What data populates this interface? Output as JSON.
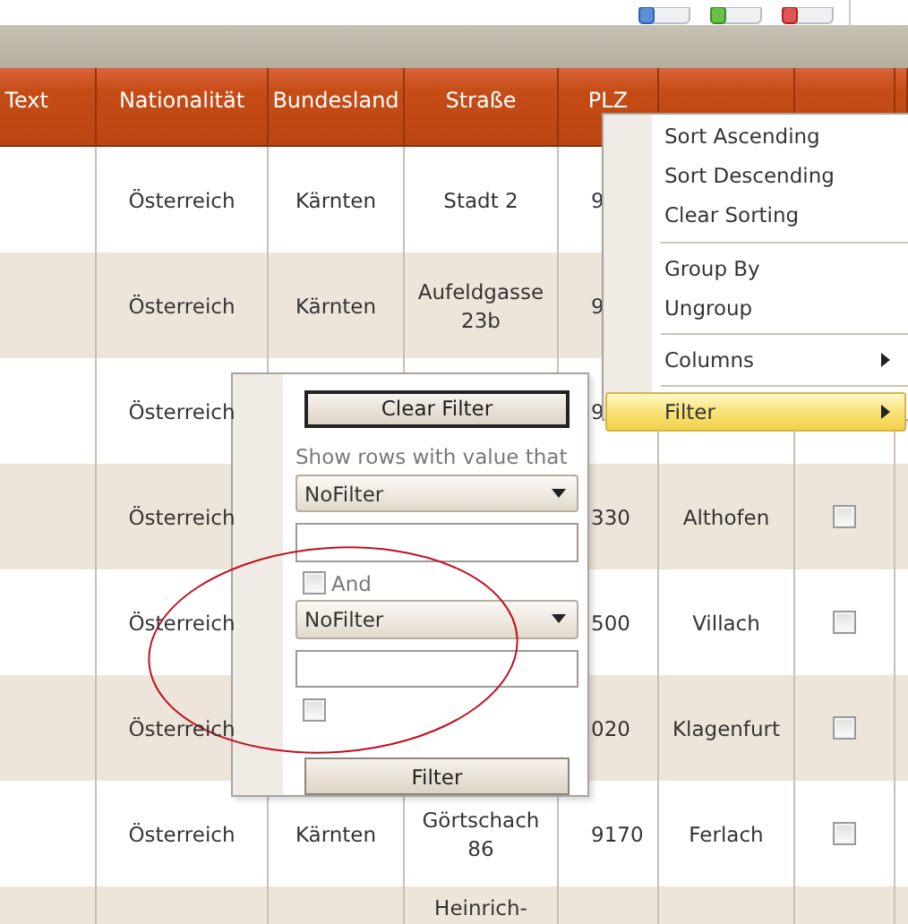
{
  "grid": {
    "columns": [
      {
        "label": "Text"
      },
      {
        "label": "Nationalität"
      },
      {
        "label": "Bundesland"
      },
      {
        "label": "Straße"
      },
      {
        "label": "PLZ"
      },
      {},
      {},
      {}
    ],
    "rows": [
      {
        "cells": [
          {
            "kind": "empty"
          },
          {
            "kind": "text",
            "text": "Österreich"
          },
          {
            "kind": "text",
            "text": "Kärnten"
          },
          {
            "kind": "text",
            "text": "Stadt 2"
          },
          {
            "kind": "text",
            "text": "9"
          },
          {
            "kind": "empty"
          },
          {
            "kind": "empty"
          },
          {
            "kind": "empty"
          }
        ]
      },
      {
        "cells": [
          {
            "kind": "empty"
          },
          {
            "kind": "text",
            "text": "Österreich"
          },
          {
            "kind": "text",
            "text": "Kärnten"
          },
          {
            "kind": "text",
            "text": "Aufeldgasse 23b"
          },
          {
            "kind": "text",
            "text": "9"
          },
          {
            "kind": "covered"
          },
          {
            "kind": "covered"
          },
          {
            "kind": "covered"
          }
        ]
      },
      {
        "cells": [
          {
            "kind": "empty"
          },
          {
            "kind": "text",
            "text": "Österreich"
          },
          {
            "kind": "empty"
          },
          {
            "kind": "empty"
          },
          {
            "kind": "text",
            "text": "9"
          },
          {
            "kind": "empty"
          },
          {
            "kind": "empty"
          },
          {
            "kind": "empty"
          }
        ]
      },
      {
        "cells": [
          {
            "kind": "empty"
          },
          {
            "kind": "text",
            "text": "Österreich"
          },
          {
            "kind": "covered"
          },
          {
            "kind": "covered"
          },
          {
            "kind": "text",
            "text": "330"
          },
          {
            "kind": "text",
            "text": "Althofen"
          },
          {
            "kind": "check",
            "checked": false
          },
          {
            "kind": "empty"
          }
        ]
      },
      {
        "cells": [
          {
            "kind": "empty"
          },
          {
            "kind": "text",
            "text": "Österreich"
          },
          {
            "kind": "empty"
          },
          {
            "kind": "empty"
          },
          {
            "kind": "text",
            "text": "500"
          },
          {
            "kind": "text",
            "text": "Villach"
          },
          {
            "kind": "check",
            "checked": false
          },
          {
            "kind": "empty"
          }
        ]
      },
      {
        "cells": [
          {
            "kind": "empty"
          },
          {
            "kind": "text",
            "text": "Österreich"
          },
          {
            "kind": "covered"
          },
          {
            "kind": "covered"
          },
          {
            "kind": "text",
            "text": "020"
          },
          {
            "kind": "text",
            "text": "Klagenfurt"
          },
          {
            "kind": "check",
            "checked": false
          },
          {
            "kind": "empty"
          }
        ]
      },
      {
        "cells": [
          {
            "kind": "empty"
          },
          {
            "kind": "text",
            "text": "Österreich"
          },
          {
            "kind": "text",
            "text": "Kärnten"
          },
          {
            "kind": "text",
            "text": "Görtschach 86"
          },
          {
            "kind": "text",
            "text": "9170"
          },
          {
            "kind": "text",
            "text": "Ferlach"
          },
          {
            "kind": "check",
            "checked": false
          },
          {
            "kind": "empty"
          }
        ]
      },
      {
        "cells": [
          {
            "kind": "empty"
          },
          {
            "kind": "empty"
          },
          {
            "kind": "empty"
          },
          {
            "kind": "text",
            "text": "Heinrich-"
          },
          {
            "kind": "empty"
          },
          {
            "kind": "empty"
          },
          {
            "kind": "empty"
          },
          {
            "kind": "empty"
          }
        ]
      }
    ]
  },
  "context_menu": {
    "items": [
      {
        "kind": "item",
        "label": "Sort Ascending",
        "selected": false
      },
      {
        "kind": "item",
        "label": "Sort Descending",
        "selected": false
      },
      {
        "kind": "item",
        "label": "Clear Sorting",
        "selected": false
      },
      {
        "kind": "separator"
      },
      {
        "kind": "item",
        "label": "Group By",
        "selected": false
      },
      {
        "kind": "item",
        "label": "Ungroup",
        "selected": false
      },
      {
        "kind": "separator"
      },
      {
        "kind": "submenu",
        "label": "Columns",
        "selected": false
      },
      {
        "kind": "separator"
      },
      {
        "kind": "submenu",
        "label": "Filter",
        "selected": true
      }
    ]
  },
  "filter_popup": {
    "clear_button": "Clear Filter",
    "prompt": "Show rows with value that",
    "condition_1": {
      "operator": "NoFilter"
    },
    "and_toggle": {
      "label": "And",
      "checked": false
    },
    "condition_2": {
      "operator": "NoFilter"
    },
    "option_toggle": {
      "checked": false
    },
    "apply_button": "Filter"
  },
  "annotations": [
    {
      "kind": "ellipse"
    }
  ]
}
